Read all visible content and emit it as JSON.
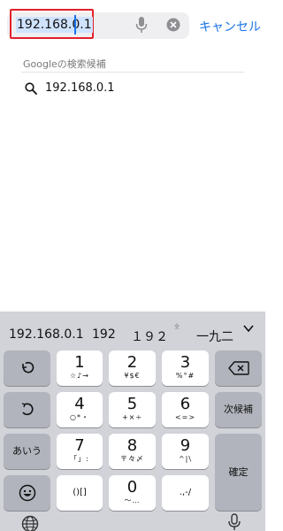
{
  "search": {
    "value": "192.168.0.1",
    "cancel_label": "キャンセル"
  },
  "suggestions": {
    "section_title": "Googleの検索候補",
    "items": [
      {
        "text": "192.168.0.1"
      }
    ]
  },
  "candidates": [
    {
      "text": "192.168.0.1"
    },
    {
      "text": "192"
    },
    {
      "text": "１９２"
    },
    {
      "text": "一九二"
    }
  ],
  "keyboard": {
    "keys": {
      "k1": {
        "num": "1",
        "sub": "☆♪→"
      },
      "k2": {
        "num": "2",
        "sub": "¥$€"
      },
      "k3": {
        "num": "3",
        "sub": "%°#"
      },
      "k4": {
        "num": "4",
        "sub": "○*・"
      },
      "k5": {
        "num": "5",
        "sub": "+×÷"
      },
      "k6": {
        "num": "6",
        "sub": "<=>"
      },
      "k7": {
        "num": "7",
        "sub": "「」:"
      },
      "k8": {
        "num": "8",
        "sub": "〒々〆"
      },
      "k9": {
        "num": "9",
        "sub": "^|\\"
      },
      "k0": {
        "num": "0",
        "sub": "〜…"
      },
      "kparen": {
        "label": "()[]"
      },
      "kpunct": {
        "label": ".,-/"
      }
    },
    "aiu_label": "あいう",
    "next_candidate_label": "次候補",
    "confirm_label": "確定",
    "small_hint": "全"
  },
  "colors": {
    "accent": "#1a73e8",
    "highlight_border": "#e3202b",
    "keyboard_bg": "#d1d3d9"
  }
}
